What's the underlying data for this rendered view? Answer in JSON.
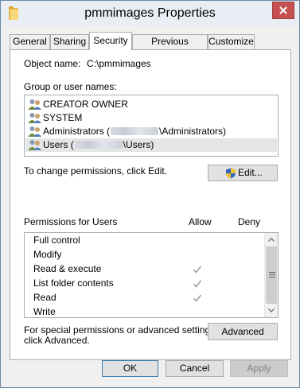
{
  "window": {
    "title": "pmmimages Properties",
    "close_glyph": "✕"
  },
  "tabs": [
    {
      "label": "General"
    },
    {
      "label": "Sharing"
    },
    {
      "label": "Security",
      "active": true
    },
    {
      "label": "Previous Versions"
    },
    {
      "label": "Customize"
    }
  ],
  "security": {
    "object_name_label": "Object name:",
    "object_name_value": "C:\\pmmimages",
    "group_label": "Group or user names:",
    "users": [
      {
        "prefix": "CREATOR OWNER",
        "suffix": ""
      },
      {
        "prefix": "SYSTEM",
        "suffix": ""
      },
      {
        "prefix": "Administrators (",
        "suffix": "\\Administrators)"
      },
      {
        "prefix": "Users (",
        "suffix": "\\Users)"
      }
    ],
    "change_text": "To change permissions, click Edit.",
    "edit_label": "Edit...",
    "perm_header": "Permissions for Users",
    "allow_header": "Allow",
    "deny_header": "Deny",
    "permissions": [
      {
        "name": "Full control",
        "allow": false,
        "deny": false
      },
      {
        "name": "Modify",
        "allow": false,
        "deny": false
      },
      {
        "name": "Read & execute",
        "allow": true,
        "deny": false
      },
      {
        "name": "List folder contents",
        "allow": true,
        "deny": false
      },
      {
        "name": "Read",
        "allow": true,
        "deny": false
      },
      {
        "name": "Write",
        "allow": false,
        "deny": false
      }
    ],
    "advanced_text_1": "For special permissions or advanced settings,",
    "advanced_text_2": "click Advanced.",
    "advanced_label": "Advanced"
  },
  "footer": {
    "ok_label": "OK",
    "cancel_label": "Cancel",
    "apply_label": "Apply"
  },
  "colors": {
    "accent": "#3c7fb1",
    "close": "#c75050",
    "check_disabled": "#a0a0a0"
  }
}
